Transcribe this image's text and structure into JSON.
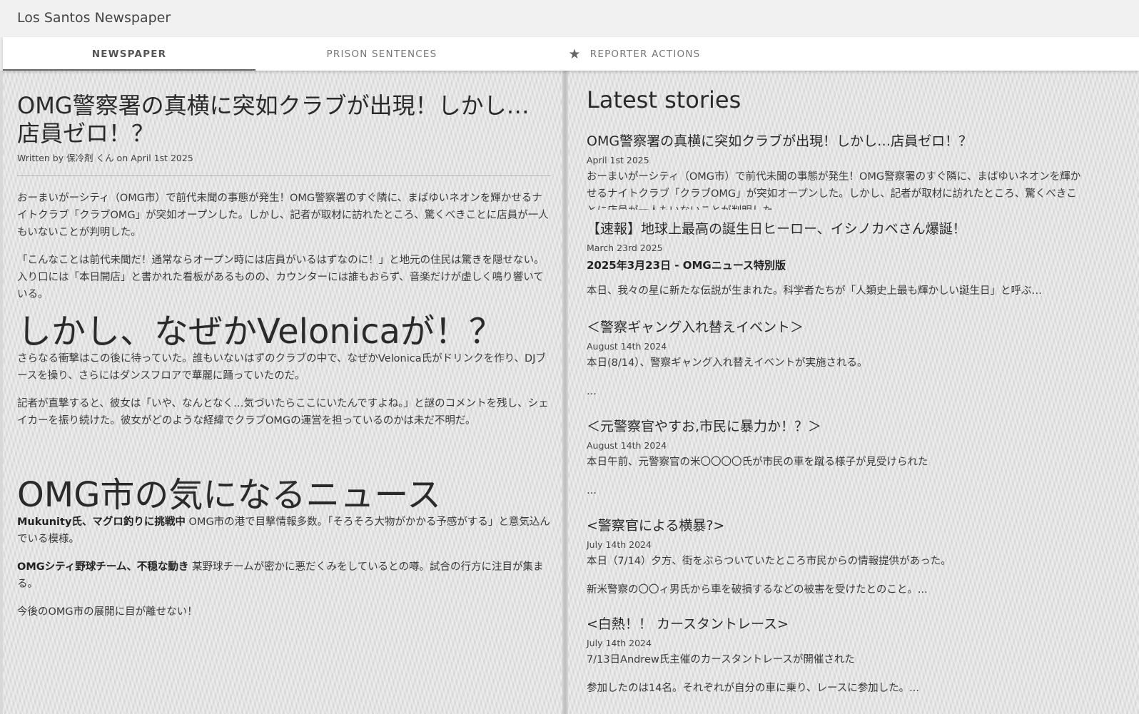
{
  "app": {
    "title": "Los Santos Newspaper"
  },
  "tabs": [
    {
      "label": "NEWSPAPER",
      "active": true
    },
    {
      "label": "PRISON SENTENCES",
      "active": false
    },
    {
      "label": "REPORTER ACTIONS",
      "active": false,
      "icon": "star-icon"
    }
  ],
  "article": {
    "headline": "OMG警察署の真横に突如クラブが出現！しかし…店員ゼロ！？",
    "byline": "Written by 保冷剤 くん on April 1st 2025",
    "paragraphs": [
      "おーまいがーシティ（OMG市）で前代未聞の事態が発生！OMG警察署のすぐ隣に、まばゆいネオンを輝かせるナイトクラブ「クラブOMG」が突如オープンした。しかし、記者が取材に訪れたところ、驚くべきことに店員が一人もいないことが判明した。",
      "「こんなことは前代未聞だ！通常ならオープン時には店員がいるはずなのに！」と地元の住民は驚きを隠せない。入り口には「本日開店」と書かれた看板があるものの、カウンターには誰もおらず、音楽だけが虚しく鳴り響いている。"
    ],
    "subheading": "しかし、なぜかVelonicaが！？",
    "paragraphs2": [
      "さらなる衝撃はこの後に待っていた。誰もいないはずのクラブの中で、なぜかVelonica氏がドリンクを作り、DJブースを操り、さらにはダンスフロアで華麗に踊っていたのだ。",
      "記者が直撃すると、彼女は「いや、なんとなく…気づいたらここにいたんですよね。」と謎のコメントを残し、シェイカーを振り続けた。彼女がどのような経緯でクラブOMGの運営を担っているのかは未だ不明だ。"
    ],
    "news_heading": "OMG市の気になるニュース",
    "news_items": [
      {
        "bold": "Mukunity氏、マグロ釣りに挑戦中",
        "text": " OMG市の港で目撃情報多数。「そろそろ大物がかかる予感がする」と意気込んでいる模様。"
      },
      {
        "bold": "OMGシティ野球チーム、不穏な動き",
        "text": " 某野球チームが密かに悪だくみをしているとの噂。試合の行方に注目が集まる。"
      }
    ],
    "closing": "今後のOMG市の展開に目が離せない！"
  },
  "latest": {
    "title": "Latest stories",
    "stories": [
      {
        "title": "OMG警察署の真横に突如クラブが出現！しかし…店員ゼロ！？",
        "date": "April 1st 2025",
        "body": "おーまいがーシティ（OMG市）で前代未聞の事態が発生！OMG警察署のすぐ隣に、まばゆいネオンを輝かせるナイトクラブ「クラブOMG」が突如オープンした。しかし、記者が取材に訪れたところ、驚くべきことに店員が一人もいないことが判明した。"
      },
      {
        "title": "【速報】地球上最高の誕生日ヒーロー、イシノカベさん爆誕！",
        "date": "March 23rd 2025",
        "bold_line": "2025年3月23日 - OMGニュース特別版",
        "body": "本日、我々の星に新たな伝説が生まれた。科学者たちが「人類史上最も輝かしい誕生日」と呼ぶ…"
      },
      {
        "title": "＜警察ギャング入れ替えイベント＞",
        "date": "August 14th 2024",
        "body": "本日(8/14）、警察ギャング入れ替えイベントが実施される。",
        "extra": "..."
      },
      {
        "title": "＜元警察官やすお,市民に暴力か！？＞",
        "date": "August 14th 2024",
        "body": "本日午前、元警察官の米〇〇〇〇氏が市民の車を蹴る様子が見受けられた",
        "extra": "..."
      },
      {
        "title": "<警察官による横暴?>",
        "date": "July 14th 2024",
        "body": "本日（7/14）夕方、街をぶらついていたところ市民からの情報提供があった。",
        "extra": "新米警察の〇〇ィ男氏から車を破損するなどの被害を受けたとのこと。..."
      },
      {
        "title": "<白熱！！ カースタントレース>",
        "date": "July 14th 2024",
        "body": "7/13日Andrew氏主催のカースタントレースが開催された",
        "extra": "参加したのは14名。それぞれが自分の車に乗り、レースに参加した。..."
      }
    ]
  }
}
